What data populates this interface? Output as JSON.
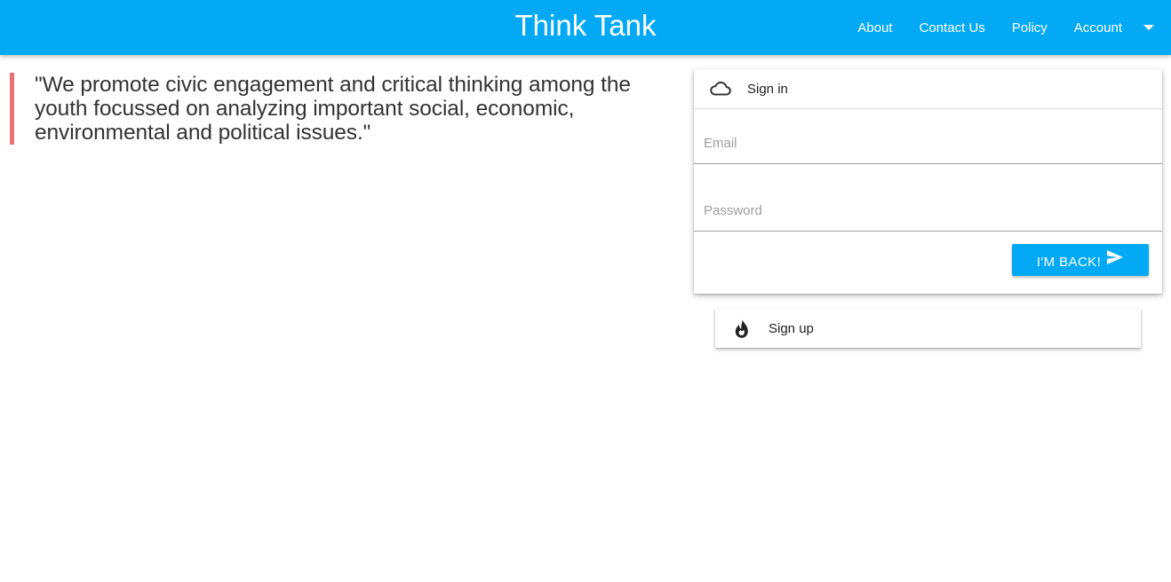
{
  "navbar": {
    "brand": "Think Tank",
    "links": [
      "About",
      "Contact Us",
      "Policy",
      "Account"
    ],
    "colors": {
      "primary": "#03a9f4"
    },
    "caret_icon": "arrow-drop-down-icon"
  },
  "quote": {
    "text": "\"We promote civic engagement and critical thinking among the youth focussed on analyzing important social, economic, environmental and political issues.\"",
    "accent_color": "#e57373"
  },
  "signin": {
    "title": "Sign in",
    "icon": "cloud-icon",
    "email_placeholder": "Email",
    "password_placeholder": "Password",
    "submit_label": "I'm back!",
    "submit_icon": "send-icon"
  },
  "signup": {
    "title": "Sign up",
    "icon": "whatshot-icon"
  }
}
